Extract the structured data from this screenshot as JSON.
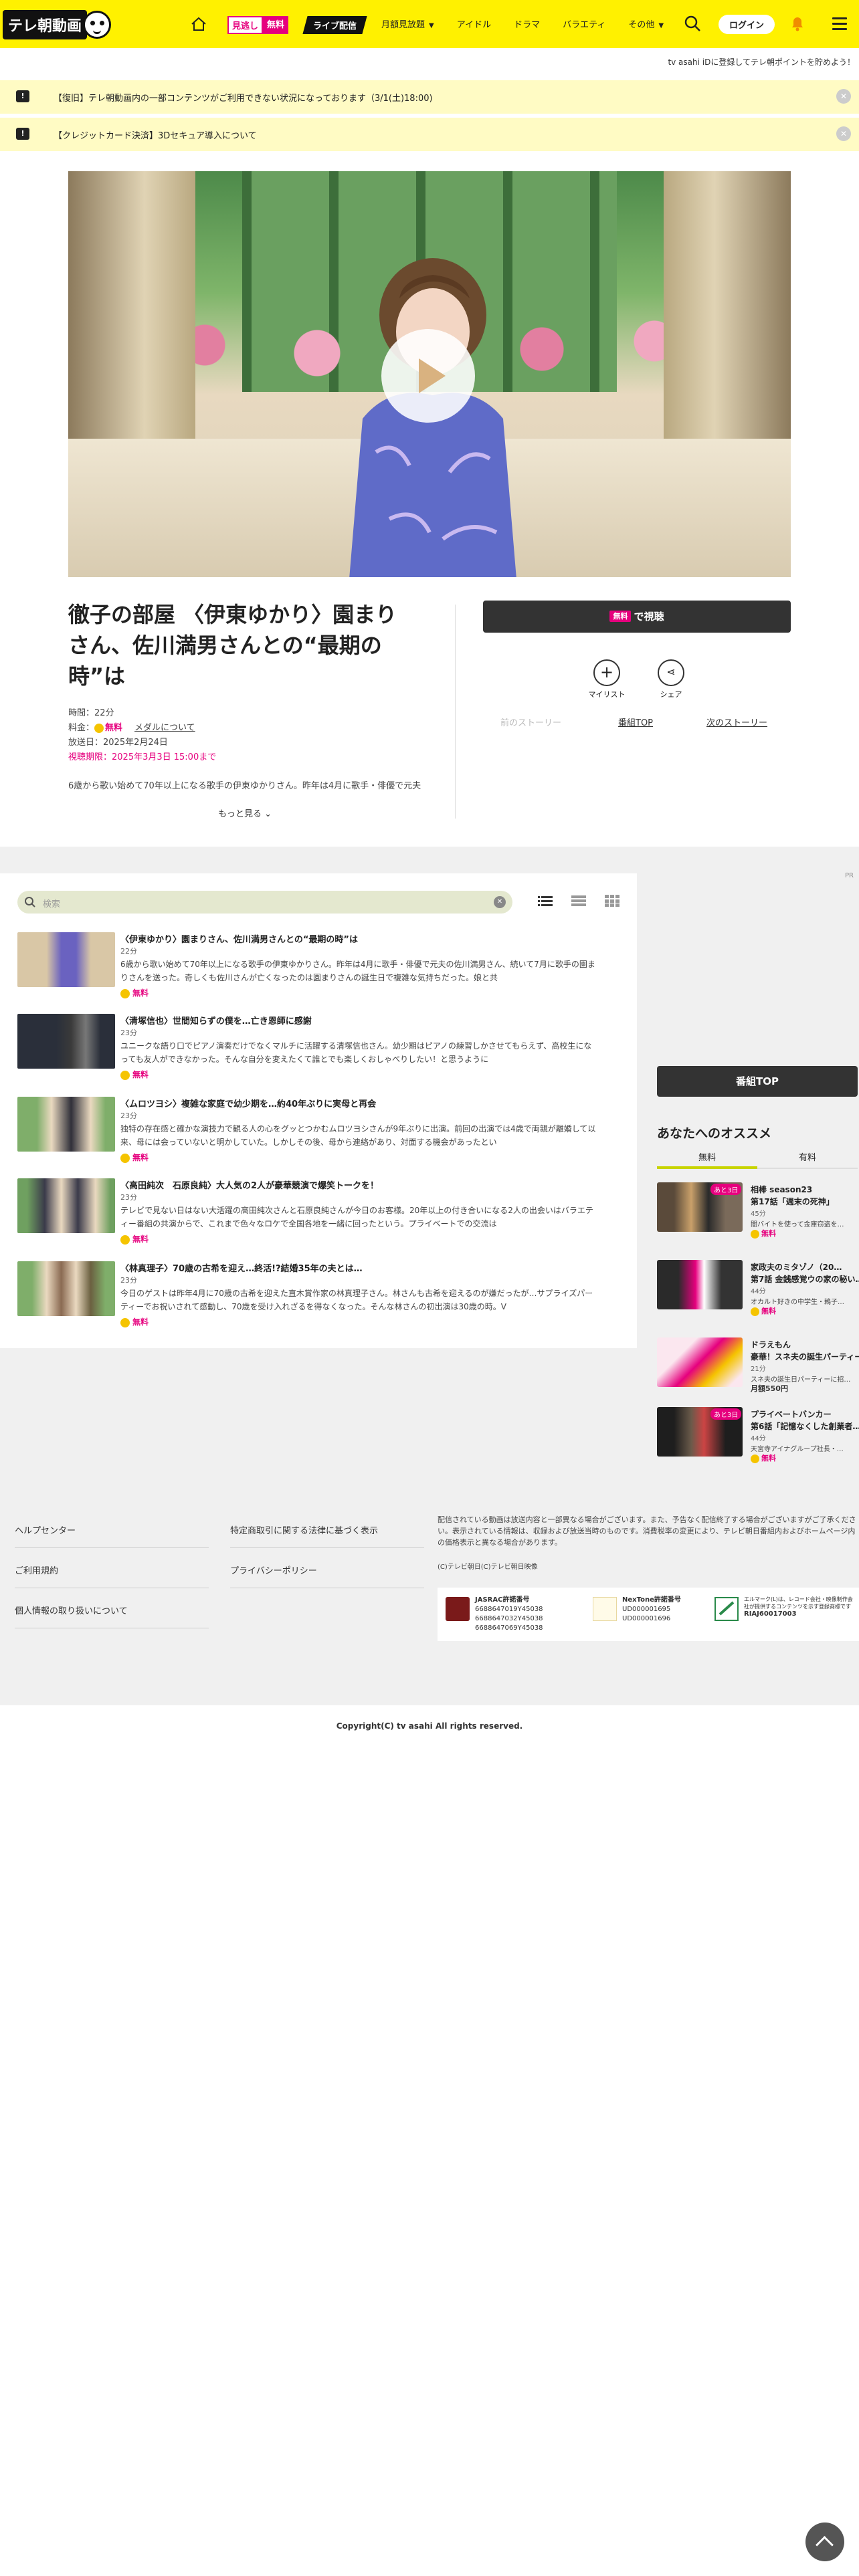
{
  "header": {
    "logo": "テレ朝動画",
    "mitoku_white": "見逃し",
    "mitoku_pink": "無料",
    "live_label": "ライブ配信",
    "nav": [
      {
        "label": "月額見放題",
        "chevron": true
      },
      {
        "label": "アイドル",
        "chevron": false
      },
      {
        "label": "ドラマ",
        "chevron": false
      },
      {
        "label": "バラエティ",
        "chevron": false
      },
      {
        "label": "その他",
        "chevron": true
      }
    ],
    "login_label": "ログイン"
  },
  "sub_link": "tv asahi iDに登録してテレ朝ポイントを貯めよう！",
  "notices": [
    {
      "text": "【復旧】テレ朝動画内の一部コンテンツがご利用できない状況になっております（3/1(土)18:00)"
    },
    {
      "text": "【クレジットカード決済】3Dセキュア導入について"
    }
  ],
  "program": {
    "title": "徹子の部屋 〈伊東ゆかり〉園まりさん、佐川満男さんとの“最期の時”は",
    "time": "時間：22分",
    "price_label": "料金：",
    "price_free": "無料",
    "medal_link": "メダルについて",
    "aired": "放送日：2025年2月24日",
    "deadline": "視聴期限：2025年3月3日 15:00まで",
    "description": "6歳から歌い始めて70年以上になる歌手の伊東ゆかりさん。昨年は4月に歌手・俳優で元夫",
    "more_label": "もっと見る"
  },
  "actions": {
    "watch_tag": "無料",
    "watch_label": "で視聴",
    "mylist": "マイリスト",
    "share": "シェア",
    "prev_story": "前のストーリー",
    "program_top": "番組TOP",
    "next_story": "次のストーリー"
  },
  "ad_tag": "PR",
  "search": {
    "placeholder": "検索"
  },
  "episodes": [
    {
      "title": "〈伊東ゆかり〉園まりさん、佐川満男さんとの“最期の時”は",
      "duration": "22分",
      "description": "6歳から歌い始めて70年以上になる歌手の伊東ゆかりさん。昨年は4月に歌手・俳優で元夫の佐川満男さん、続いて7月に歌手の園まりさんを送った。奇しくも佐川さんが亡くなったのは園まりさんの誕生日で複雑な気持ちだった。娘と共",
      "free": "無料"
    },
    {
      "title": "〈清塚信也〉世間知らずの僕を…亡き恩師に感謝",
      "duration": "23分",
      "description": "ユニークな語り口でピアノ演奏だけでなくマルチに活躍する清塚信也さん。幼少期はピアノの練習しかさせてもらえず、高校生になっても友人ができなかった。そんな自分を変えたくて誰とでも楽しくおしゃべりしたい！と思うように",
      "free": "無料"
    },
    {
      "title": "〈ムロツヨシ〉複雑な家庭で幼少期を…約40年ぶりに実母と再会",
      "duration": "23分",
      "description": "独特の存在感と確かな演技力で観る人の心をグッとつかむムロツヨシさんが9年ぶりに出演。前回の出演では4歳で両親が離婚して以来、母には会っていないと明かしていた。しかしその後、母から連絡があり、対面する機会があったとい",
      "free": "無料"
    },
    {
      "title": "〈高田純次　石原良純〉大人気の2人が豪華競演で爆笑トークを！",
      "duration": "23分",
      "description": "テレビで見ない日はない大活躍の高田純次さんと石原良純さんが今日のお客様。20年以上の付き合いになる2人の出会いはバラエティー番組の共演からで、これまで色々なロケで全国各地を一緒に回ったという。プライベートでの交流は",
      "free": "無料"
    },
    {
      "title": "〈林真理子〉70歳の古希を迎え…終活!?結婚35年の夫とは…",
      "duration": "23分",
      "description": "今日のゲストは昨年4月に70歳の古希を迎えた直木賞作家の林真理子さん。林さんも古希を迎えるのが嫌だったが…サプライズパーティーでお祝いされて感動し、70歳を受け入れざるを得なくなった。そんな林さんの初出演は30歳の時。V",
      "free": "無料"
    }
  ],
  "sidebar": {
    "program_top": "番組TOP",
    "reco_title": "あなたへのオススメ",
    "tab_free": "無料",
    "tab_paid": "有料",
    "items": [
      {
        "tag": "あと3日",
        "title": "相棒 season23",
        "subtitle": "第17話「週末の死神」",
        "duration": "45分",
        "desc": "闇バイトを使って金庫窃盗を…",
        "price": "無料",
        "paid": false
      },
      {
        "tag": "",
        "title": "家政夫のミタゾノ（20…",
        "subtitle": "第7話 金銭感覚ウの家の秘い…",
        "duration": "44分",
        "desc": "オカルト好きの中学生・鶫子…",
        "price": "無料",
        "paid": false
      },
      {
        "tag": "",
        "title": "ドラえもん",
        "subtitle": "豪華！スネ夫の誕生パーティー",
        "duration": "21分",
        "desc": "スネ夫の誕生日パーティーに招…",
        "price": "月額550円",
        "paid": true
      },
      {
        "tag": "あと3日",
        "title": "プライベートバンカー",
        "subtitle": "第6話「記憶なくした創業者…",
        "duration": "44分",
        "desc": "天宮寺アイナグループ社長・…",
        "price": "無料",
        "paid": false
      }
    ]
  },
  "footer": {
    "links_left": [
      "ヘルプセンター",
      "ご利用規約",
      "個人情報の取り扱いについて"
    ],
    "links_right": [
      "特定商取引に関する法律に基づく表示",
      "プライバシーポリシー"
    ],
    "note": "配信されている動画は放送内容と一部異なる場合がございます。また、予告なく配信終了する場合がございますがご了承ください。表示されている情報は、収録および放送当時のものです。消費税率の変更により、テレビ朝日番組内およびホームページ内の価格表示と異なる場合があります。",
    "small_copy": "(C)テレビ朝日(C)テレビ朝日映像",
    "jasrac_title": "JASRAC許諾番号",
    "jasrac_nums": [
      "6688647019Y45038",
      "6688647032Y45038",
      "6688647069Y45038"
    ],
    "nextone_title": "NexTone許諾番号",
    "nextone_nums": [
      "UD000001695",
      "UD000001696"
    ],
    "riaj_text": "エルマーク(L)は、レコード会社・映像制作会社が提供するコンテンツを示す登録商標です",
    "riaj_num": "RIAJ60017003",
    "copyright": "Copyright(C) tv asahi All rights reserved."
  }
}
